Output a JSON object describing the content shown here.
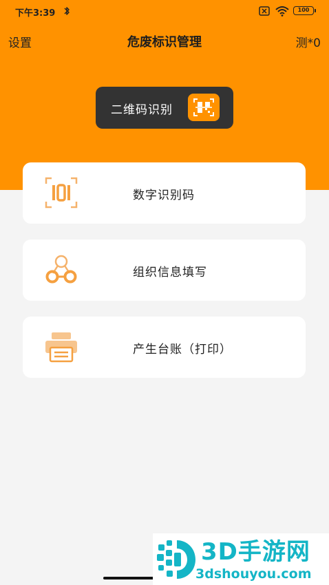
{
  "status_bar": {
    "time": "下午3:39",
    "battery": "100"
  },
  "nav": {
    "left_label": "设置",
    "title": "危废标识管理",
    "right_label": "测*0"
  },
  "qr_button": {
    "label": "二维码识别",
    "icon": "qr-scan-icon"
  },
  "menu": {
    "items": [
      {
        "label": "数字识别码",
        "icon": "digit-code-icon"
      },
      {
        "label": "组织信息填写",
        "icon": "organization-icon"
      },
      {
        "label": "产生台账（打印）",
        "icon": "printer-icon"
      }
    ]
  },
  "watermark": {
    "brand": "3D手游网",
    "domain": "3dshouyou.com"
  },
  "colors": {
    "accent": "#ff9200",
    "dark_button": "#333333",
    "background": "#f4f4f4",
    "watermark": "#14b5c6"
  }
}
